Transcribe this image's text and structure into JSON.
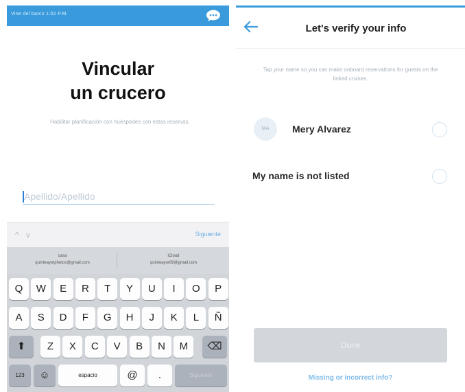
{
  "left_screen": {
    "status_bar": {
      "text": "Vine del barco 1:02 P.M."
    },
    "title_line1": "Vincular",
    "title_line2": "un crucero",
    "subtitle": "Habilitar planificación con huéspedes con estas reservas.",
    "name_input": {
      "placeholder": "Apellido/Apellido",
      "value": ""
    },
    "accessory": {
      "prev_arrow": "^",
      "next_arrow": "v",
      "next_label": "Siguiente"
    },
    "suggestions": [
      {
        "title": "casa",
        "email": "quinteayorphotos@gmail.com"
      },
      {
        "title": "iCloud",
        "email": "quinteayor89@gmail.com"
      }
    ],
    "keyboard": {
      "row1": [
        "Q",
        "W",
        "E",
        "R",
        "T",
        "Y",
        "U",
        "I",
        "O",
        "P"
      ],
      "row2": [
        "A",
        "S",
        "D",
        "F",
        "G",
        "H",
        "J",
        "K",
        "L",
        "Ñ"
      ],
      "row3": [
        "Z",
        "X",
        "C",
        "V",
        "B",
        "N",
        "M"
      ],
      "shift_key": "⬆",
      "delete_key": "⌫",
      "numbers_key": "123",
      "emoji_key": "☺",
      "space_key": "espacio",
      "at_key": "@",
      "dot_key": ".",
      "return_key": "Siguiente"
    }
  },
  "right_screen": {
    "header": {
      "back_icon": "arrow-left-icon",
      "title": "Let's verify your info"
    },
    "subtitle": "Tap your name so you can make onboard reservations for guests on the linked cruises.",
    "options": [
      {
        "initials": "MA",
        "label": "Mery Alvarez",
        "selected": false
      },
      {
        "label": "My name is not listed",
        "selected": false
      }
    ],
    "done_label": "Done",
    "missing_link": "Missing or incorrect info?"
  },
  "colors": {
    "accent": "#3a9bdc",
    "link": "#7fbbe8",
    "disabled_button": "#d3d7dc"
  }
}
